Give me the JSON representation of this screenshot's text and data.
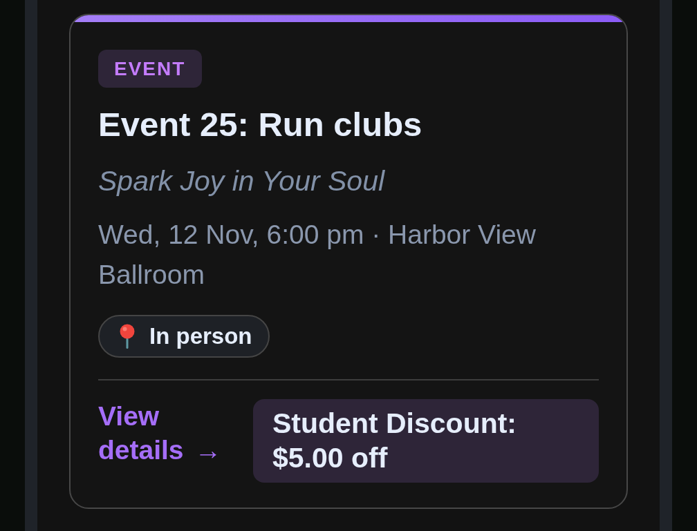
{
  "event": {
    "badge": "EVENT",
    "title": "Event 25: Run clubs",
    "tagline": "Spark Joy in Your Soul",
    "meta": "Wed, 12 Nov, 6:00 pm · Harbor View Ballroom",
    "attendance": {
      "label": "In person"
    },
    "link": {
      "label": "View details",
      "arrow": "→"
    },
    "offer": "Student Discount: $5.00 off"
  }
}
